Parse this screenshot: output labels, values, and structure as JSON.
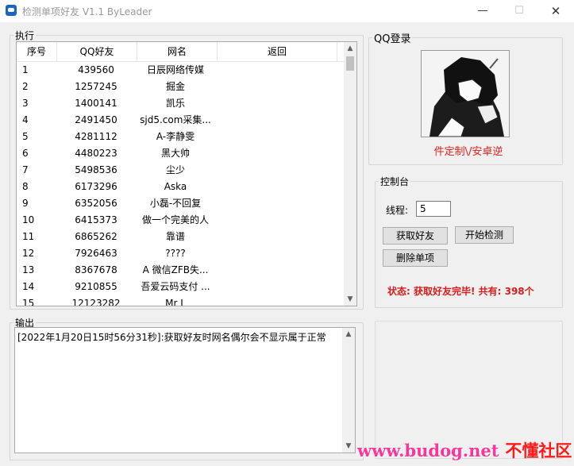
{
  "window": {
    "title": "检测单项好友  V1.1   ByLeader",
    "minimize": "—",
    "maximize": "☐",
    "close": "✕"
  },
  "exec": {
    "legend": "执行",
    "columns": [
      "序号",
      "QQ好友",
      "网名",
      "返回"
    ],
    "rows": [
      [
        "1",
        "439560",
        "日辰网络传媒",
        ""
      ],
      [
        "2",
        "1257245",
        "掘金",
        ""
      ],
      [
        "3",
        "1400141",
        "凯乐",
        ""
      ],
      [
        "4",
        "2491450",
        "sjd5.com采集...",
        ""
      ],
      [
        "5",
        "4281112",
        "A-李静雯",
        ""
      ],
      [
        "6",
        "4480223",
        "黑大帅",
        ""
      ],
      [
        "7",
        "5498536",
        "尘少",
        ""
      ],
      [
        "8",
        "6173296",
        "Aska",
        ""
      ],
      [
        "9",
        "6352056",
        "小磊-不回复",
        ""
      ],
      [
        "10",
        "6415373",
        "做一个完美的人",
        ""
      ],
      [
        "11",
        "6865262",
        "靠谱",
        ""
      ],
      [
        "12",
        "7926463",
        "????",
        ""
      ],
      [
        "13",
        "8367678",
        "A 微信ZFB失...",
        ""
      ],
      [
        "14",
        "9210855",
        "吾爱云码支付 ...",
        ""
      ],
      [
        "15",
        "12123282",
        "Mr L",
        ""
      ]
    ]
  },
  "login": {
    "legend": "QQ登录",
    "custom_label": "件定制\\/安卓逆"
  },
  "console": {
    "legend": "控制台",
    "thread_label": "线程:",
    "thread_value": "5",
    "get_friends": "获取好友",
    "start_check": "开始检测",
    "delete_item": "删除单项",
    "status": "状态: 获取好友完毕! 共有: 398个"
  },
  "output": {
    "legend": "输出",
    "log": "[2022年1月20日15时56分31秒]:获取好友时网名偶尔会不显示属于正常"
  },
  "watermark": {
    "url": "www.budog.net",
    "cn": "不懂社区"
  },
  "colors": {
    "status_red": "#d81c1c",
    "label_red": "#e02020",
    "watermark_pink": "#ff3399"
  }
}
